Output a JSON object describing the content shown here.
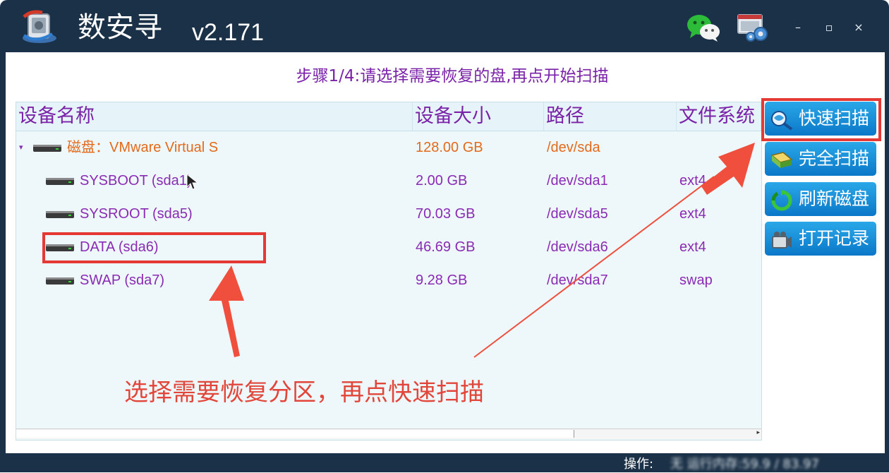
{
  "app": {
    "title": "数安寻",
    "version": "v2.171",
    "icon": "app-logo-icon"
  },
  "titlebar": {
    "wechat_icon": "wechat-icon",
    "settings_icon": "settings-gear-icon",
    "minimize": "–",
    "maximize": "▫",
    "close": "×"
  },
  "step_text": "步骤1/4:请选择需要恢复的盘,再点开始扫描",
  "table": {
    "headers": [
      "设备名称",
      "设备大小",
      "路径",
      "文件系统"
    ],
    "rows": [
      {
        "name": "磁盘：VMware Virtual S",
        "size": "128.00 GB",
        "path": "/dev/sda",
        "fs": "",
        "type": "disk"
      },
      {
        "name": "SYSBOOT (sda1)",
        "size": "2.00 GB",
        "path": "/dev/sda1",
        "fs": "ext4",
        "type": "partition"
      },
      {
        "name": "SYSROOT (sda5)",
        "size": "70.03 GB",
        "path": "/dev/sda5",
        "fs": "ext4",
        "type": "partition"
      },
      {
        "name": "DATA (sda6)",
        "size": "46.69 GB",
        "path": "/dev/sda6",
        "fs": "ext4",
        "type": "partition"
      },
      {
        "name": "SWAP (sda7)",
        "size": "9.28 GB",
        "path": "/dev/sda7",
        "fs": "swap",
        "type": "partition"
      }
    ]
  },
  "side_buttons": [
    {
      "label": "快速扫描",
      "icon": "quick-scan-icon"
    },
    {
      "label": "完全扫描",
      "icon": "full-scan-icon"
    },
    {
      "label": "刷新磁盘",
      "icon": "refresh-icon"
    },
    {
      "label": "打开记录",
      "icon": "camera-record-icon"
    }
  ],
  "annotation": {
    "text": "选择需要恢复分区，再点快速扫描",
    "color": "#e2463a"
  },
  "status": {
    "label": "操作:",
    "value": "无 运行内存:59.9 / 83.97"
  },
  "colors": {
    "titlebar_bg": "#1b3147",
    "text_purple": "#8a2bb3",
    "disk_orange": "#e36a1b",
    "button_blue": "#0b78c8",
    "highlight_red": "#e53935"
  }
}
